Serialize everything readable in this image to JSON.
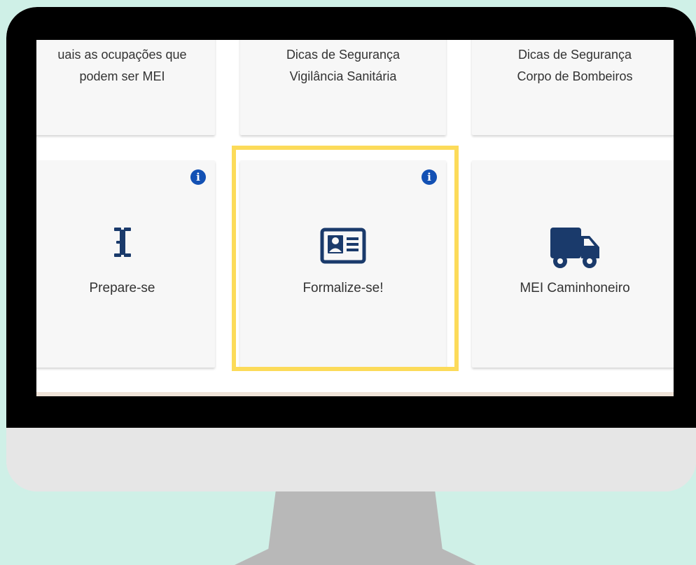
{
  "top_cards": [
    {
      "label_line1": "uais as ocupações que",
      "label_line2": "podem ser MEI"
    },
    {
      "label_line1": "Dicas de Segurança",
      "label_line2": "Vigilância Sanitária"
    },
    {
      "label_line1": "Dicas de Segurança",
      "label_line2": "Corpo de Bombeiros"
    }
  ],
  "bottom_cards": [
    {
      "label": "Prepare-se",
      "icon": "tools-icon",
      "has_info": true
    },
    {
      "label": "Formalize-se!",
      "icon": "id-card-icon",
      "has_info": true,
      "highlighted": true
    },
    {
      "label": "MEI Caminhoneiro",
      "icon": "truck-icon",
      "has_info": false
    }
  ],
  "info_glyph": "i",
  "colors": {
    "background": "#cff0e7",
    "icon_navy": "#1a3a6b",
    "info_blue": "#1351b4",
    "highlight": "#fcdb59"
  }
}
